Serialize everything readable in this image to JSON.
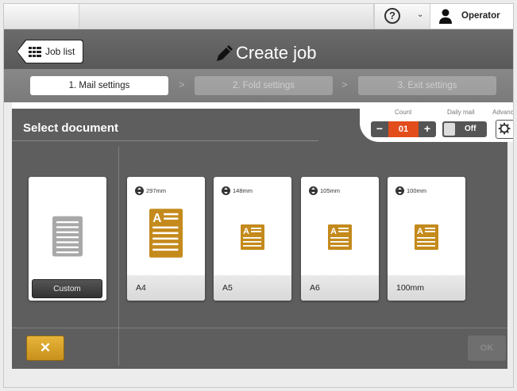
{
  "header": {
    "help_icon": "question-circle-icon",
    "operator_label": "Operator"
  },
  "titlebar": {
    "job_list_label": "Job list",
    "title": "Create job"
  },
  "steps": [
    {
      "label": "1. Mail settings",
      "active": true
    },
    {
      "label": "2. Fold settings",
      "active": false
    },
    {
      "label": "3. Exit settings",
      "active": false
    }
  ],
  "controls": {
    "count_label": "Count",
    "count_value": "01",
    "minus_label": "−",
    "plus_label": "+",
    "daily_mail_label": "Daily mail",
    "daily_mail_value": "Off",
    "advanced_label": "Advanced"
  },
  "main": {
    "section_title": "Select document",
    "custom_button_label": "Custom",
    "documents": [
      {
        "name": "A4",
        "size": "297mm"
      },
      {
        "name": "A5",
        "size": "148mm"
      },
      {
        "name": "A6",
        "size": "105mm"
      },
      {
        "name": "100mm",
        "size": "100mm"
      }
    ]
  },
  "footer": {
    "cancel_label": "✕",
    "ok_label": "OK"
  },
  "colors": {
    "accent_orange": "#e34c1b",
    "document_gold": "#c48a1c",
    "cancel_yellow": "#d9a12b"
  }
}
